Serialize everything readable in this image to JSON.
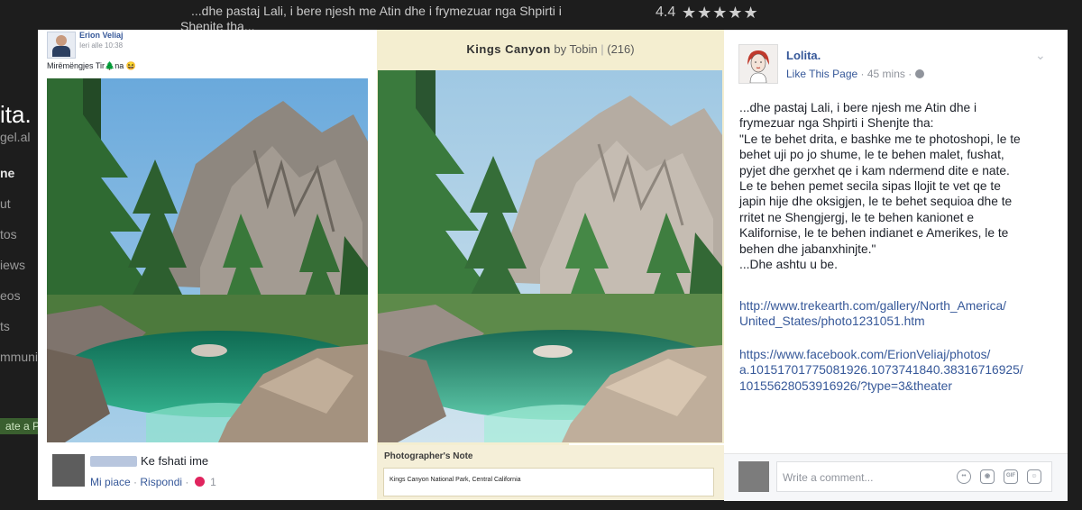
{
  "background": {
    "top_text_1": "...dhe pastaj Lali, i bere njesh me Atin dhe i frymezuar nga Shpirti i",
    "top_text_2": "Shenjte tha...",
    "rating": "4.4",
    "rating_stars": "★★★★★",
    "page_name_fragment": "ita.",
    "page_handle_fragment": "gel.al",
    "nav_fragments": [
      "ne",
      "ut",
      "tos",
      "iews",
      "eos",
      "ts",
      "mmuni"
    ],
    "create_button_fragment": "ate a P"
  },
  "left_post": {
    "author": "Erion Veliaj",
    "time": "Ieri alle 10:38",
    "text": "Mirëmëngjes Tir🌲na 😆",
    "comment_text": "Ke fshati ime",
    "comment_like": "Mi piace",
    "comment_reply": "Rispondi",
    "reaction_count": "1"
  },
  "right_page": {
    "title": "Kings Canyon",
    "by": "by Tobin",
    "count": "(216)",
    "note_label": "Photographer's Note",
    "note_text": "Kings Canyon National Park, Central California"
  },
  "sidebar": {
    "page_name": "Lolita.",
    "like_link": "Like This Page",
    "time_ago": "45 mins",
    "caption_lines": [
      "...dhe pastaj Lali, i bere njesh me Atin dhe i",
      "frymezuar nga Shpirti i Shenjte tha:",
      "\"Le te behet drita, e bashke me te photoshopi, le te",
      "behet uji po jo shume, le te behen malet, fushat,",
      "pyjet dhe gerxhet qe i kam ndermend dite e nate.",
      "Le te behen pemet secila sipas llojit te vet qe te",
      "japin hije dhe oksigjen, le te behet sequioa dhe te",
      "rritet ne Shengjergj, le te behen kanionet e",
      "Kalifornise, le te behen indianet e Amerikes, le te",
      "behen dhe jabanxhinjte.\"",
      "...Dhe ashtu u be."
    ],
    "link1_lines": [
      "http://www.trekearth.com/gallery/North_America/",
      "United_States/photo1231051.htm"
    ],
    "link2_lines": [
      "https://www.facebook.com/ErionVeliaj/photos/",
      "a.10151701775081926.1073741840.38316716925/",
      "10155628053916926/?type=3&theater"
    ],
    "comment_placeholder": "Write a comment...",
    "gif_label": "GIF"
  }
}
